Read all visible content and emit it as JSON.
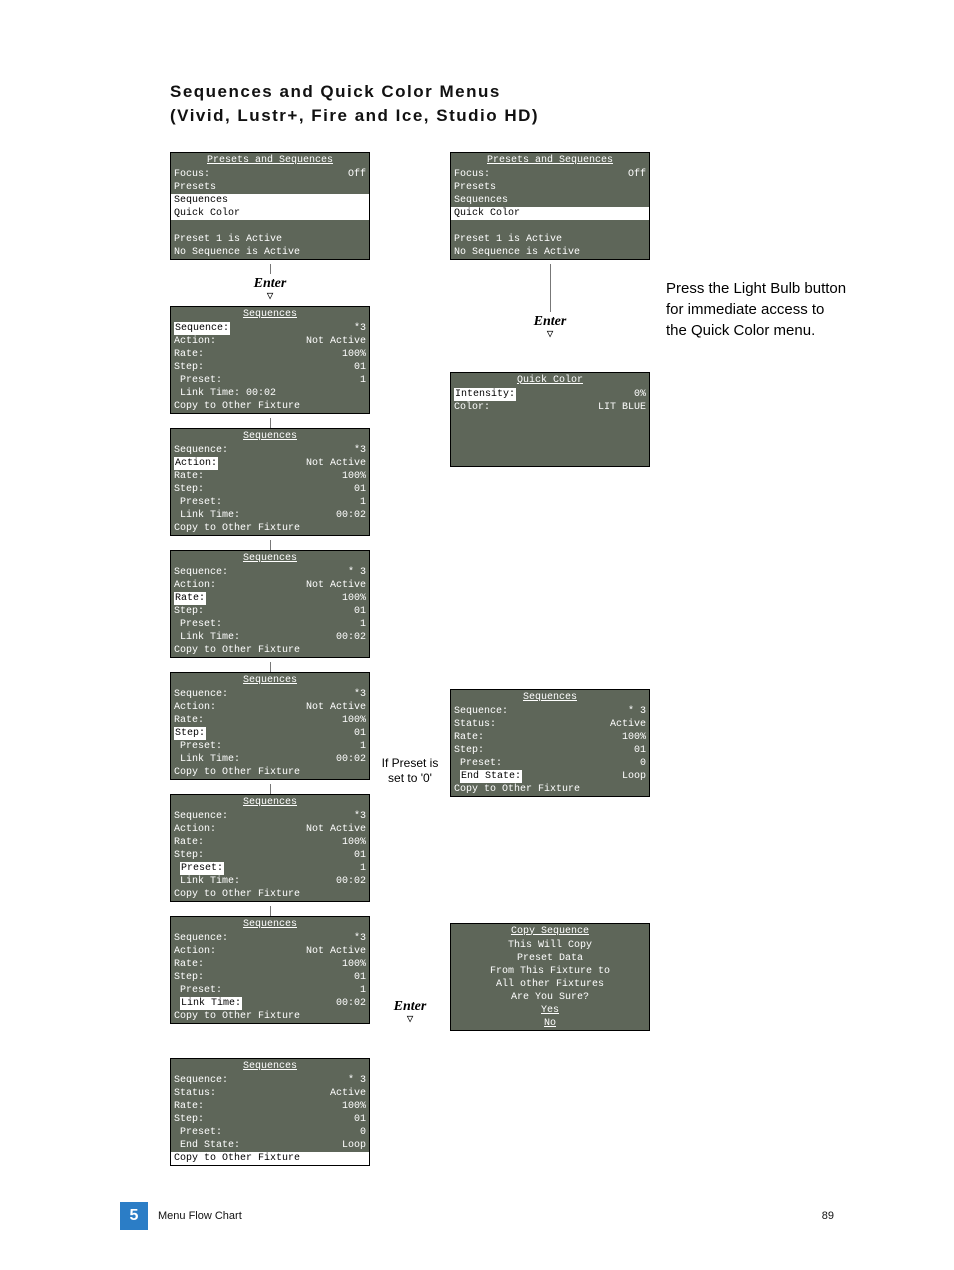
{
  "page": {
    "title_line1": "Sequences and Quick Color Menus",
    "title_line2": "(Vivid, Lustr+, Fire and Ice, Studio HD)",
    "section_number": "5",
    "section_label": "Menu Flow Chart",
    "page_number": "89"
  },
  "labels": {
    "enter": "Enter",
    "preset_note_1": "If Preset is",
    "preset_note_2": "set to '0'",
    "side_text_1": "Press the Light Bulb button",
    "side_text_2": "for immediate access  to",
    "side_text_3": "the Quick Color menu."
  },
  "prefix": {
    "focus": "Focus:",
    "presets": "Presets",
    "sequences": "Sequences",
    "quick_color": "Quick Color",
    "sequence": "Sequence:",
    "action": "Action:",
    "rate": "Rate:",
    "step": "Step:",
    "preset": "Preset:",
    "link_time": "Link Time:",
    "copy_to": "Copy to Other Fixture",
    "status": "Status:",
    "end_state": "End State:",
    "intensity": "Intensity:",
    "color": "Color:"
  },
  "panel_titles": {
    "presets_and_sequences": "Presets and Sequences",
    "sequences": "Sequences",
    "quick_color": "Quick Color",
    "copy_sequence": "Copy Sequence"
  },
  "top_panel": {
    "focus_value": "Off",
    "status1": "Preset 1 is Active",
    "status2": "No Sequence is Active"
  },
  "seq_a": {
    "sequence": "*3",
    "action": "Not Active",
    "rate": "100%",
    "step": "01",
    "preset": "1",
    "link_time_label": "Link Time: 00:02"
  },
  "seq_b": {
    "sequence": "*3",
    "action": "Not Active",
    "rate": "100%",
    "step": "01",
    "preset": "1",
    "link_time": "00:02"
  },
  "seq_c": {
    "sequence": "* 3",
    "action": "Not Active",
    "rate": "100%",
    "step": "01",
    "preset": "1",
    "link_time": "00:02"
  },
  "seq_d": {
    "sequence": "*3",
    "action": "Not Active",
    "rate": "100%",
    "step": "01",
    "preset": "1",
    "link_time": "00:02"
  },
  "seq_e": {
    "sequence": "*3",
    "action": "Not Active",
    "rate": "100%",
    "step": "01",
    "preset": "1",
    "link_time": "00:02"
  },
  "seq_f": {
    "sequence": "*3",
    "action": "Not Active",
    "rate": "100%",
    "step": "01",
    "preset": "1",
    "link_time": "00:02"
  },
  "seq_g": {
    "sequence": "* 3",
    "status": "Active",
    "rate": "100%",
    "step": "01",
    "preset": "0",
    "end_state": "Loop"
  },
  "seq_h": {
    "sequence": "* 3",
    "status": "Active",
    "rate": "100%",
    "step": "01",
    "preset": "0",
    "end_state": "Loop"
  },
  "quick_color": {
    "intensity": "0%",
    "color": "LIT BLUE"
  },
  "copy_seq": {
    "l1": "This Will Copy",
    "l2": "Preset Data",
    "l3": "From This Fixture to",
    "l4": "All other Fixtures",
    "l5": "Are You Sure?",
    "yes": "Yes",
    "no": "No"
  }
}
